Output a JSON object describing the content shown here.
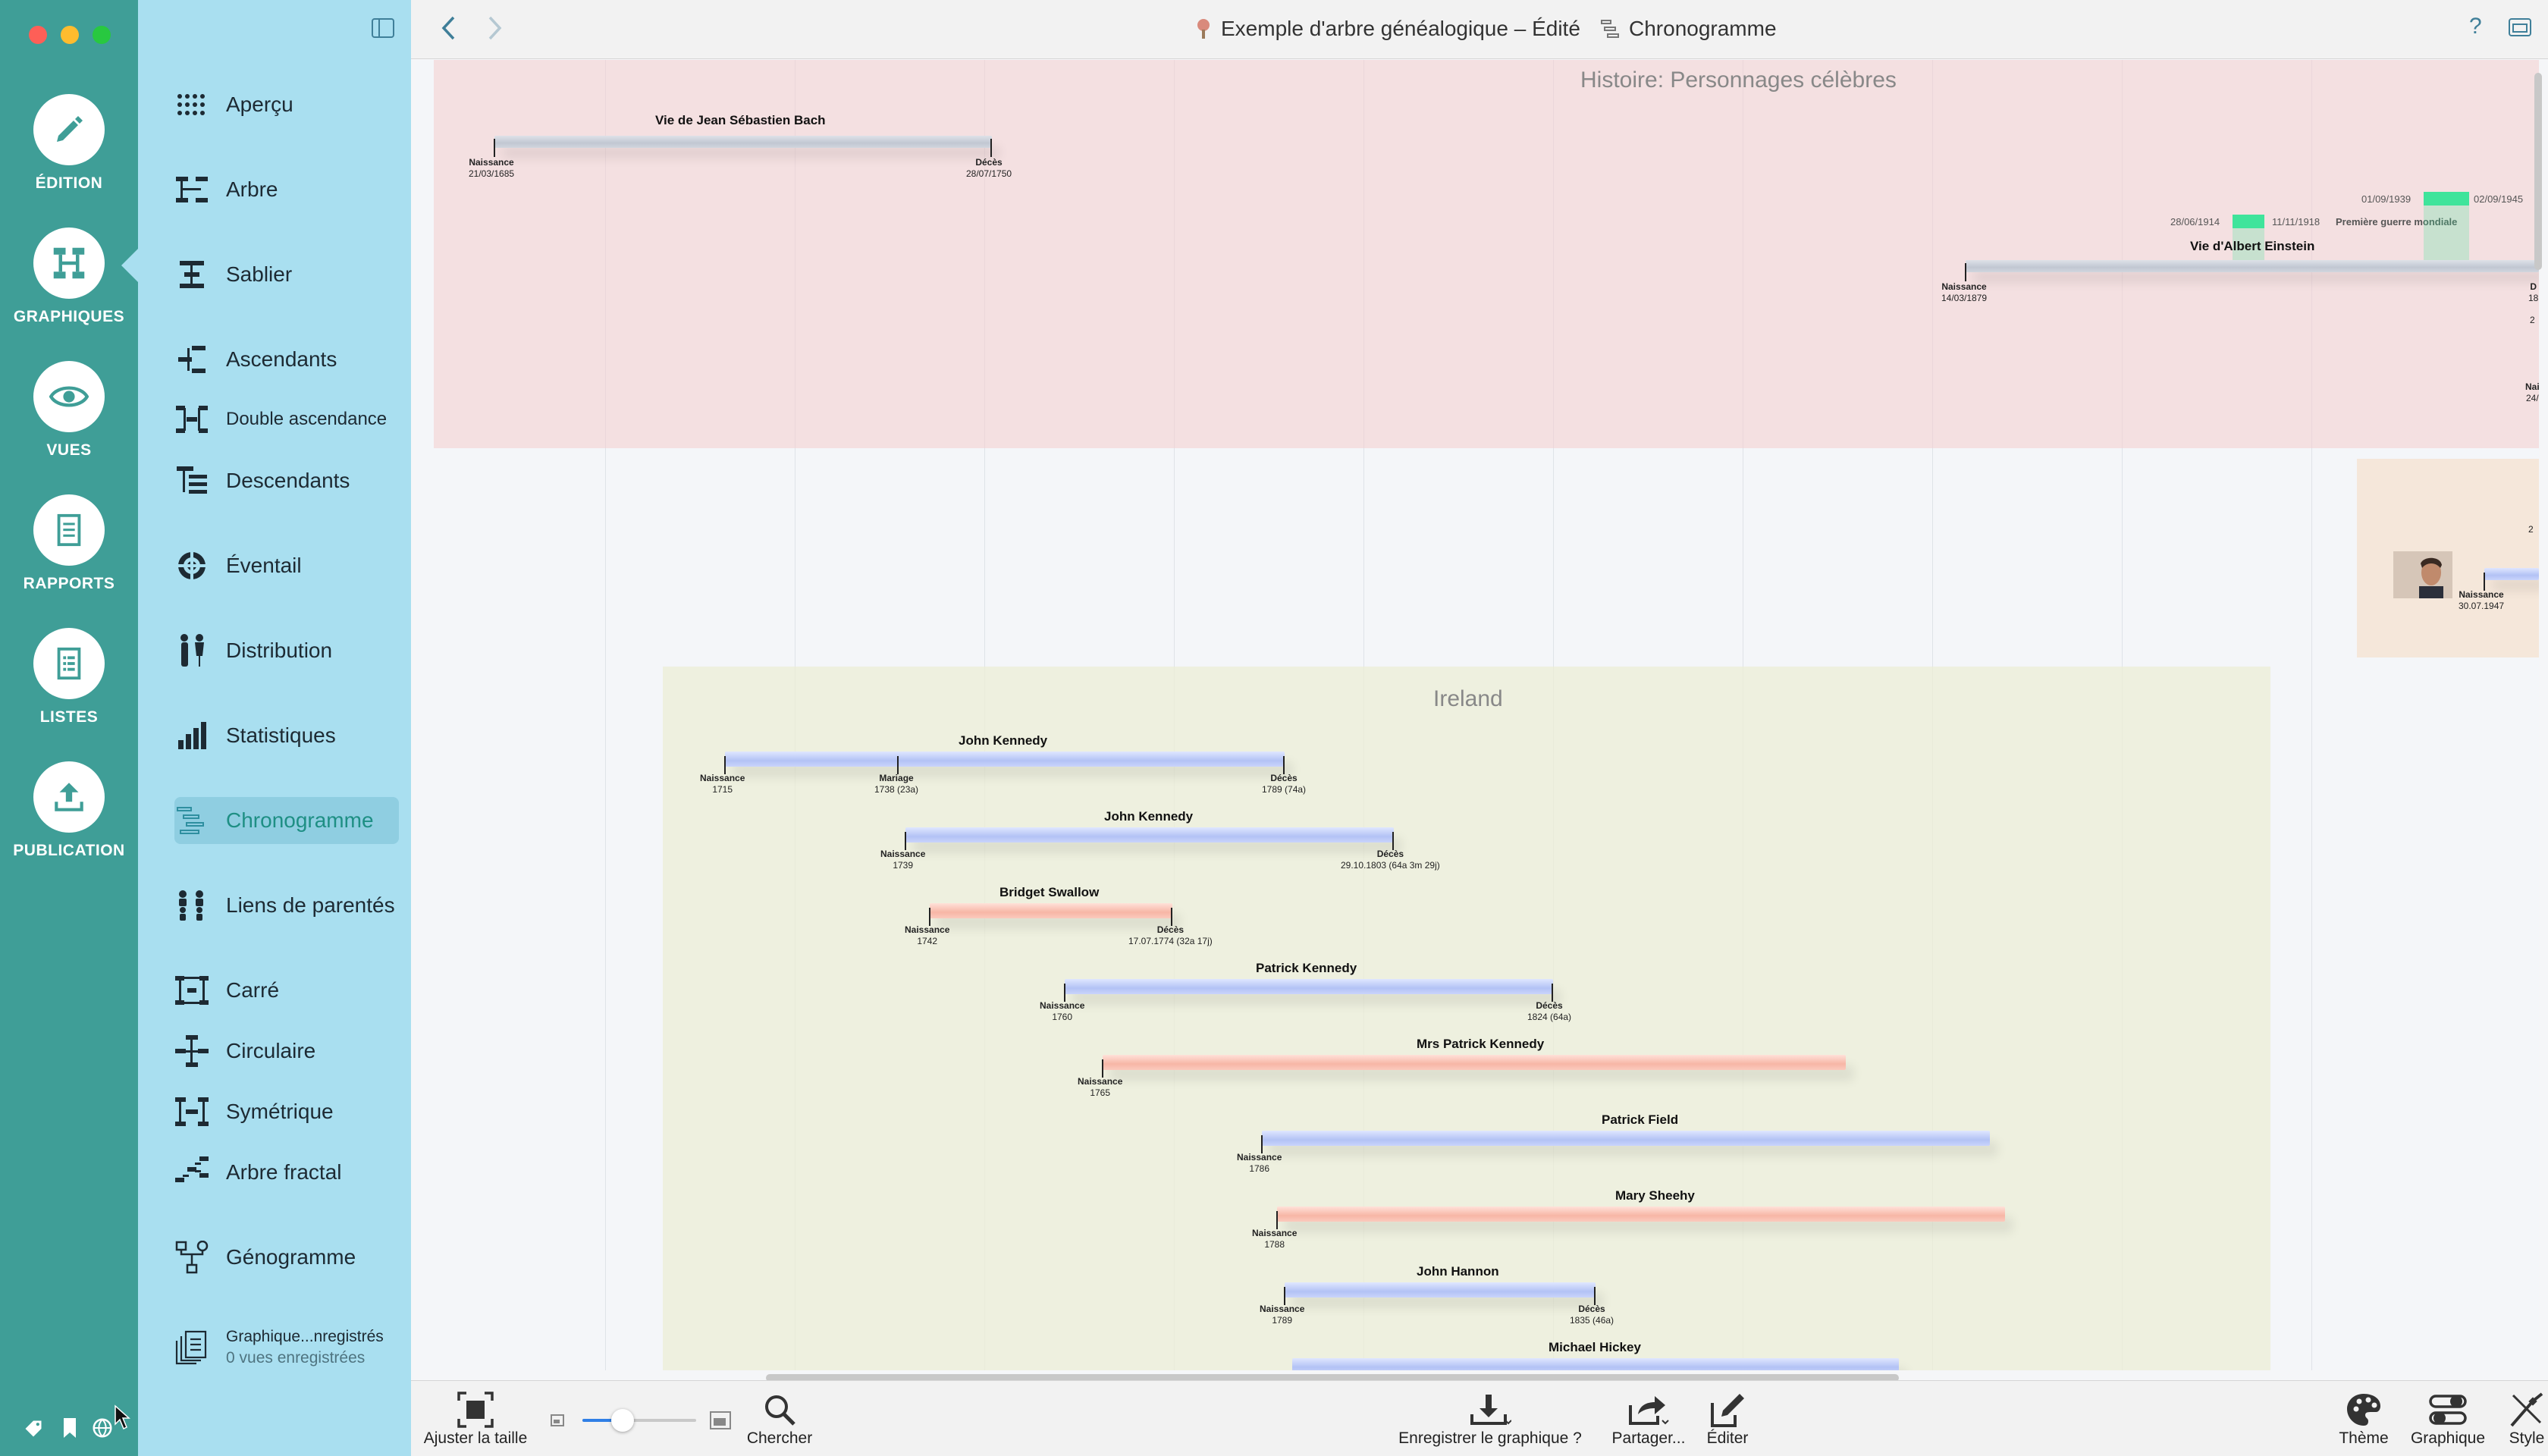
{
  "window": {
    "title": "Exemple d'arbre généalogique – Édité",
    "view_title": "Chronogramme"
  },
  "rail": {
    "items": [
      {
        "label": "ÉDITION",
        "icon": "pencil-icon"
      },
      {
        "label": "GRAPHIQUES",
        "icon": "chart-icon"
      },
      {
        "label": "VUES",
        "icon": "eye-icon"
      },
      {
        "label": "RAPPORTS",
        "icon": "document-icon"
      },
      {
        "label": "LISTES",
        "icon": "list-icon"
      },
      {
        "label": "PUBLICATION",
        "icon": "upload-icon"
      }
    ],
    "accent": "#3f9e97"
  },
  "sidebar": {
    "items": [
      {
        "label": "Aperçu"
      },
      {
        "label": "Arbre"
      },
      {
        "label": "Sablier"
      },
      {
        "label": "Ascendants"
      },
      {
        "label": "Double ascendance"
      },
      {
        "label": "Descendants"
      },
      {
        "label": "Éventail"
      },
      {
        "label": "Distribution"
      },
      {
        "label": "Statistiques"
      },
      {
        "label": "Chronogramme"
      },
      {
        "label": "Liens de parentés"
      },
      {
        "label": "Carré"
      },
      {
        "label": "Circulaire"
      },
      {
        "label": "Symétrique"
      },
      {
        "label": "Arbre fractal"
      },
      {
        "label": "Génogramme"
      }
    ],
    "saved": {
      "label": "Graphique...nregistrés",
      "sub": "0 vues enregistrées"
    },
    "background": "#a9dff0"
  },
  "chart": {
    "regions": {
      "histoire": "Histoire: Personnages célèbres",
      "ireland": "Ireland"
    },
    "bach": {
      "name": "Vie de Jean Sébastien Bach",
      "birth_label": "Naissance",
      "birth_date": "21/03/1685",
      "death_label": "Décès",
      "death_date": "28/07/1750"
    },
    "einstein": {
      "name": "Vie d'Albert Einstein",
      "birth_label": "Naissance",
      "birth_date": "14/03/1879",
      "death_stub": "D",
      "death_stub_date": "18"
    },
    "wars": {
      "ww1_start": "28/06/1914",
      "ww1_end": "11/11/1918",
      "ww1_label": "Première guerre mondiale",
      "ww2_start": "01/09/1939",
      "ww2_end": "02/09/1945"
    },
    "edge_stubs": {
      "a": "2",
      "b": "Nai",
      "c": "24/",
      "d": "2"
    },
    "portrait": {
      "birth_label": "Naissance",
      "birth_date": "30.07.1947"
    },
    "people": [
      {
        "name": "John Kennedy",
        "birth_label": "Naissance",
        "birth": "1715",
        "marriage_label": "Mariage",
        "marriage": "1738 (23a)",
        "death_label": "Décès",
        "death": "1789 (74a)"
      },
      {
        "name": "John Kennedy",
        "birth_label": "Naissance",
        "birth": "1739",
        "death_label": "Décès",
        "death": "29.10.1803 (64a 3m 29j)"
      },
      {
        "name": "Bridget Swallow",
        "birth_label": "Naissance",
        "birth": "1742",
        "death_label": "Décès",
        "death": "17.07.1774 (32a 17j)"
      },
      {
        "name": "Patrick Kennedy",
        "birth_label": "Naissance",
        "birth": "1760",
        "death_label": "Décès",
        "death": "1824 (64a)"
      },
      {
        "name": "Mrs Patrick Kennedy",
        "birth_label": "Naissance",
        "birth": "1765"
      },
      {
        "name": "Patrick Field",
        "birth_label": "Naissance",
        "birth": "1786"
      },
      {
        "name": "Mary Sheehy",
        "birth_label": "Naissance",
        "birth": "1788"
      },
      {
        "name": "John Hannon",
        "birth_label": "Naissance",
        "birth": "1789",
        "death_label": "Décès",
        "death": "1835 (46a)"
      },
      {
        "name": "Michael Hickey"
      }
    ]
  },
  "toolbar": {
    "fit": "Ajuster la taille",
    "search": "Chercher",
    "save": "Enregistrer le graphique ?",
    "share": "Partager...",
    "edit": "Éditer",
    "theme": "Thème",
    "graph": "Graphique",
    "style": "Style",
    "zoom_level": 0.35
  }
}
